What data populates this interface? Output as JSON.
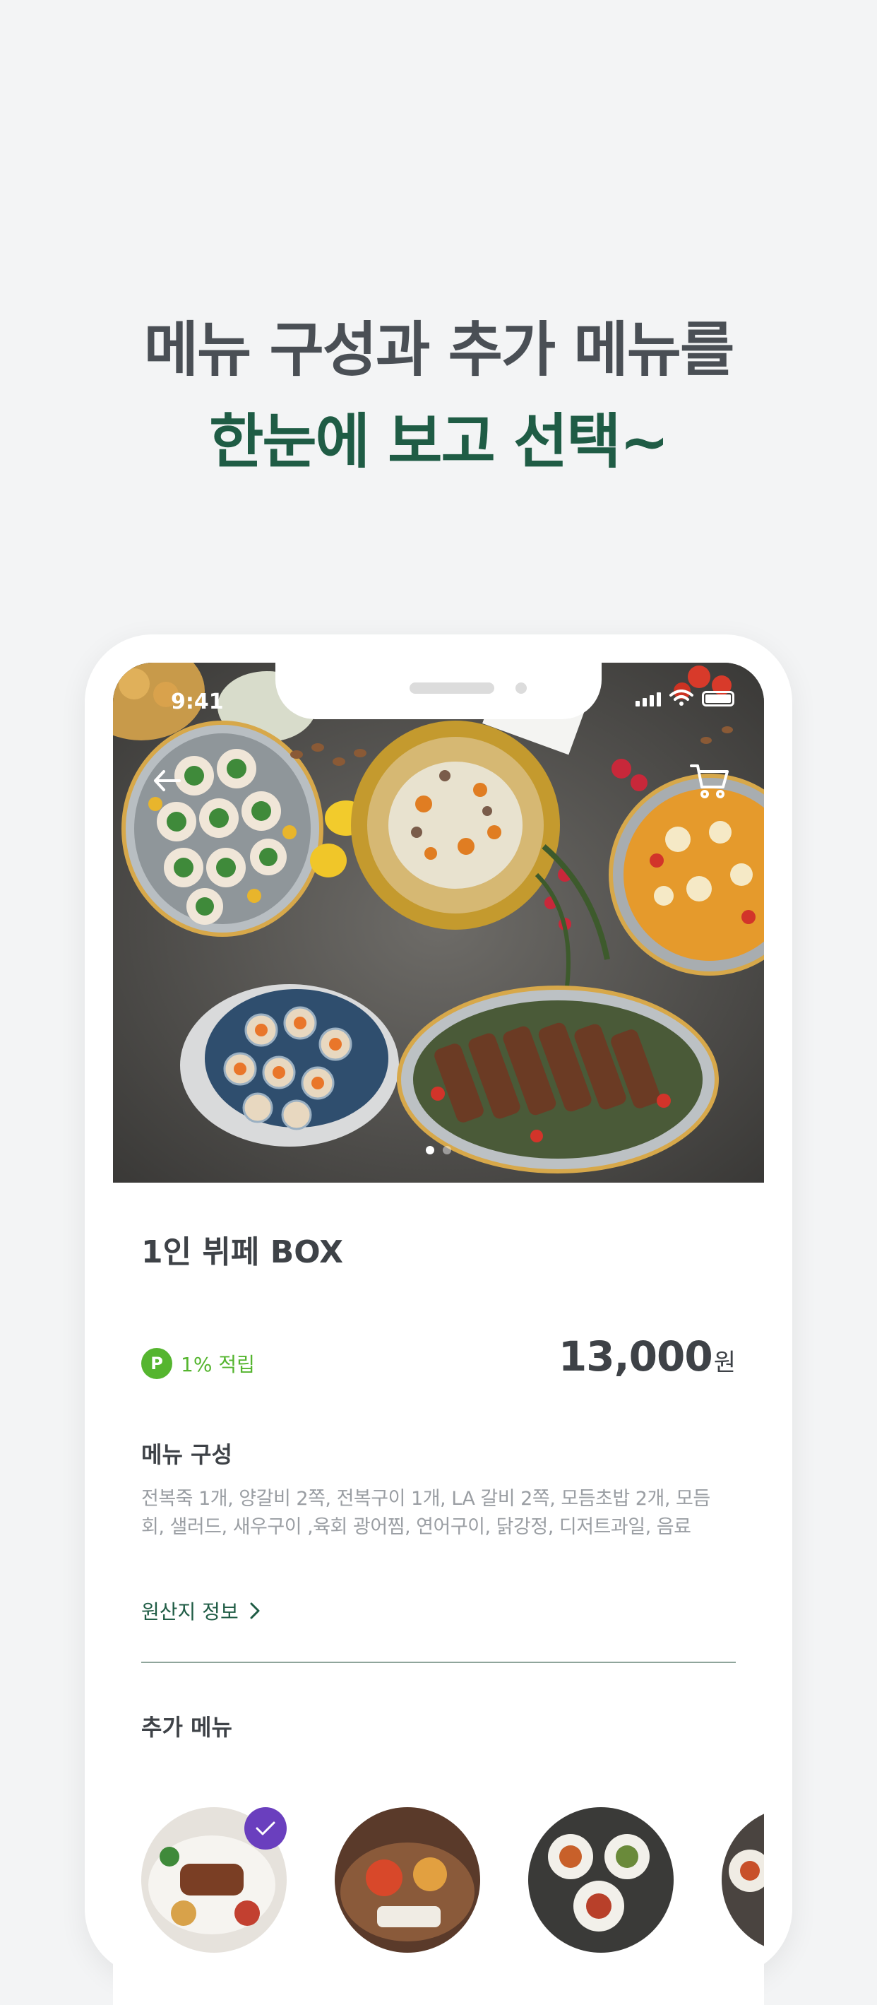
{
  "headline": {
    "line1": "메뉴 구성과 추가 메뉴를",
    "line2": "한눈에 보고 선택~"
  },
  "status_bar": {
    "time": "9:41"
  },
  "colors": {
    "background": "#f3f4f5",
    "headline_gray": "#4a4f55",
    "headline_green": "#1f5c45",
    "points_green": "#55b52f",
    "check_purple": "#6a3fbe"
  },
  "icons": {
    "back": "back-arrow-icon",
    "cart": "cart-icon",
    "points": "point-badge-icon",
    "chevron": "chevron-right-icon",
    "check": "check-icon"
  },
  "carousel": {
    "total": 2,
    "active": 1
  },
  "product": {
    "title": "1인 뷔페 BOX",
    "points_badge": "P",
    "points_label": "1% 적립",
    "price": "13,000",
    "price_unit": "원"
  },
  "menu_composition": {
    "title": "메뉴 구성",
    "description": "전복죽 1개, 양갈비 2쪽, 전복구이 1개, LA 갈비 2쪽, 모듬초밥 2개, 모듬회, 샐러드, 새우구이 ,육회 광어찜, 연어구이, 닭강정, 디저트과일, 음료"
  },
  "origin_link": {
    "label": "원산지 정보"
  },
  "additional_menu": {
    "title": "추가 메뉴",
    "items": [
      {
        "selected": true
      },
      {
        "selected": false
      },
      {
        "selected": false
      },
      {
        "selected": false
      }
    ]
  }
}
